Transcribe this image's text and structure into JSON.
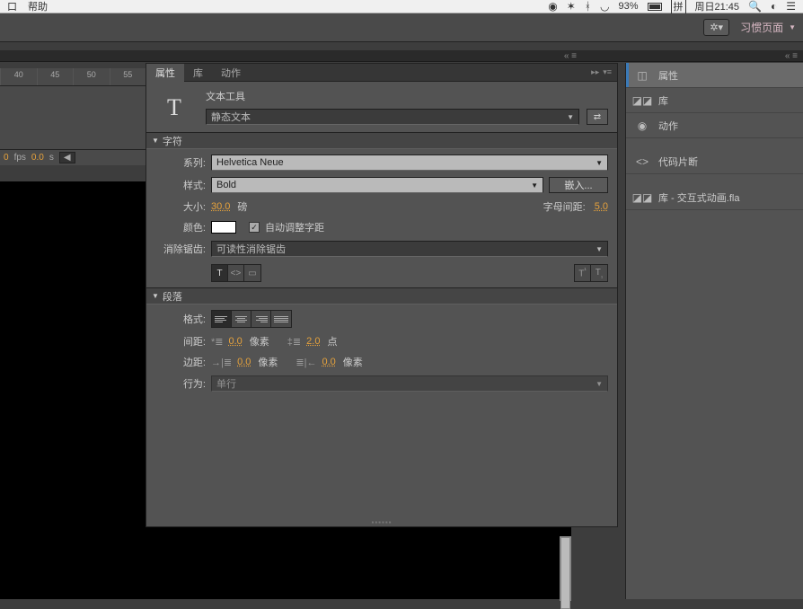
{
  "mac_menu": {
    "window": "口",
    "help": "帮助",
    "battery_pct": "93%",
    "ime": "拼",
    "clock": "周日21:45"
  },
  "toolbar": {
    "workspace_label": "习惯页面"
  },
  "timeline": {
    "marks": [
      "40",
      "45",
      "50",
      "55"
    ],
    "fps_label": "fps",
    "fps_val": "0",
    "time_val": "0.0",
    "time_unit": "s"
  },
  "tabs": {
    "properties": "属性",
    "library": "库",
    "actions": "动作"
  },
  "tool": {
    "icon_glyph": "T",
    "title": "文本工具",
    "type_dd": "静态文本"
  },
  "char_section": "字符",
  "char": {
    "family_label": "系列:",
    "family_val": "Helvetica Neue",
    "style_label": "样式:",
    "style_val": "Bold",
    "embed_btn": "嵌入...",
    "size_label": "大小:",
    "size_val": "30.0",
    "size_unit": "磅",
    "tracking_label": "字母间距:",
    "tracking_val": "5.0",
    "color_label": "颜色:",
    "autokern_label": "自动调整字距",
    "antialias_label": "消除锯齿:",
    "antialias_val": "可读性消除锯齿"
  },
  "para_section": "段落",
  "para": {
    "format_label": "格式:",
    "spacing_label": "间距:",
    "indent1_val": "0.0",
    "indent1_unit": "像素",
    "leading_val": "2.0",
    "leading_unit": "点",
    "margin_label": "边距:",
    "margin1_val": "0.0",
    "margin1_unit": "像素",
    "margin2_val": "0.0",
    "margin2_unit": "像素",
    "behavior_label": "行为:",
    "behavior_val": "单行"
  },
  "sidebar": {
    "items": [
      {
        "label": "属性"
      },
      {
        "label": "库"
      },
      {
        "label": "动作"
      }
    ],
    "code_snippets": "代码片断",
    "doc_lib": "库 - 交互式动画.fla"
  }
}
